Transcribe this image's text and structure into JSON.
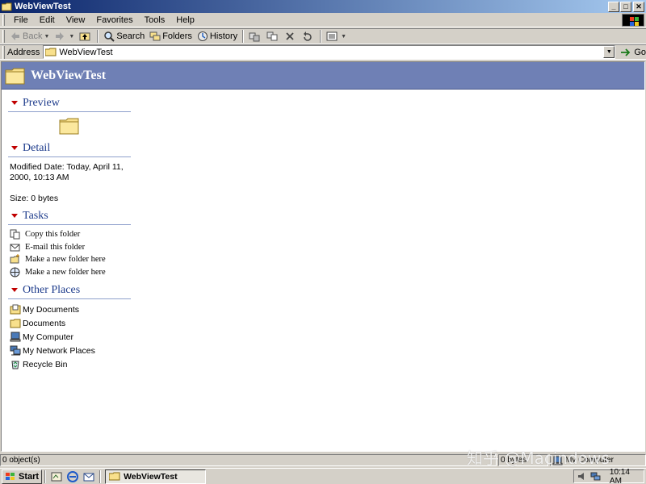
{
  "window": {
    "title": "WebViewTest",
    "controls": {
      "minimize": "_",
      "maximize": "□",
      "close": "✕"
    }
  },
  "menubar": {
    "items": [
      "File",
      "Edit",
      "View",
      "Favorites",
      "Tools",
      "Help"
    ]
  },
  "toolbar": {
    "back_label": "Back",
    "search_label": "Search",
    "folders_label": "Folders",
    "history_label": "History"
  },
  "addressbar": {
    "label": "Address",
    "value": "WebViewTest",
    "go_label": "Go"
  },
  "banner": {
    "title": "WebViewTest"
  },
  "sections": {
    "preview": {
      "title": "Preview"
    },
    "detail": {
      "title": "Detail",
      "modified": "Modified Date: Today, April 11, 2000, 10:13 AM",
      "size": "Size: 0 bytes"
    },
    "tasks": {
      "title": "Tasks",
      "items": [
        {
          "label": "Copy this folder",
          "icon": "copy-folder-icon"
        },
        {
          "label": "E-mail this folder",
          "icon": "email-icon"
        },
        {
          "label": "Make a new folder here",
          "icon": "new-folder-icon"
        },
        {
          "label": "Make a new folder here",
          "icon": "globe-folder-icon"
        }
      ]
    },
    "other_places": {
      "title": "Other Places",
      "items": [
        {
          "label": "My Documents",
          "icon": "my-documents-icon"
        },
        {
          "label": "Documents",
          "icon": "folder-icon"
        },
        {
          "label": "My Computer",
          "icon": "my-computer-icon"
        },
        {
          "label": "My Network Places",
          "icon": "network-places-icon"
        },
        {
          "label": "Recycle Bin",
          "icon": "recycle-bin-icon"
        }
      ]
    }
  },
  "statusbar": {
    "objects": "0 object(s)",
    "size": "0 bytes",
    "zone": "My Computer"
  },
  "taskbar": {
    "start_label": "Start",
    "active_window": "WebViewTest",
    "clock": "10:14 AM"
  },
  "watermark": "知乎 @Macindows",
  "colors": {
    "banner": "#6f80b5",
    "section_title": "#1e3c8c",
    "collapse_arrow": "#c00000",
    "titlebar_start": "#0a246a",
    "titlebar_end": "#a6caf0"
  }
}
